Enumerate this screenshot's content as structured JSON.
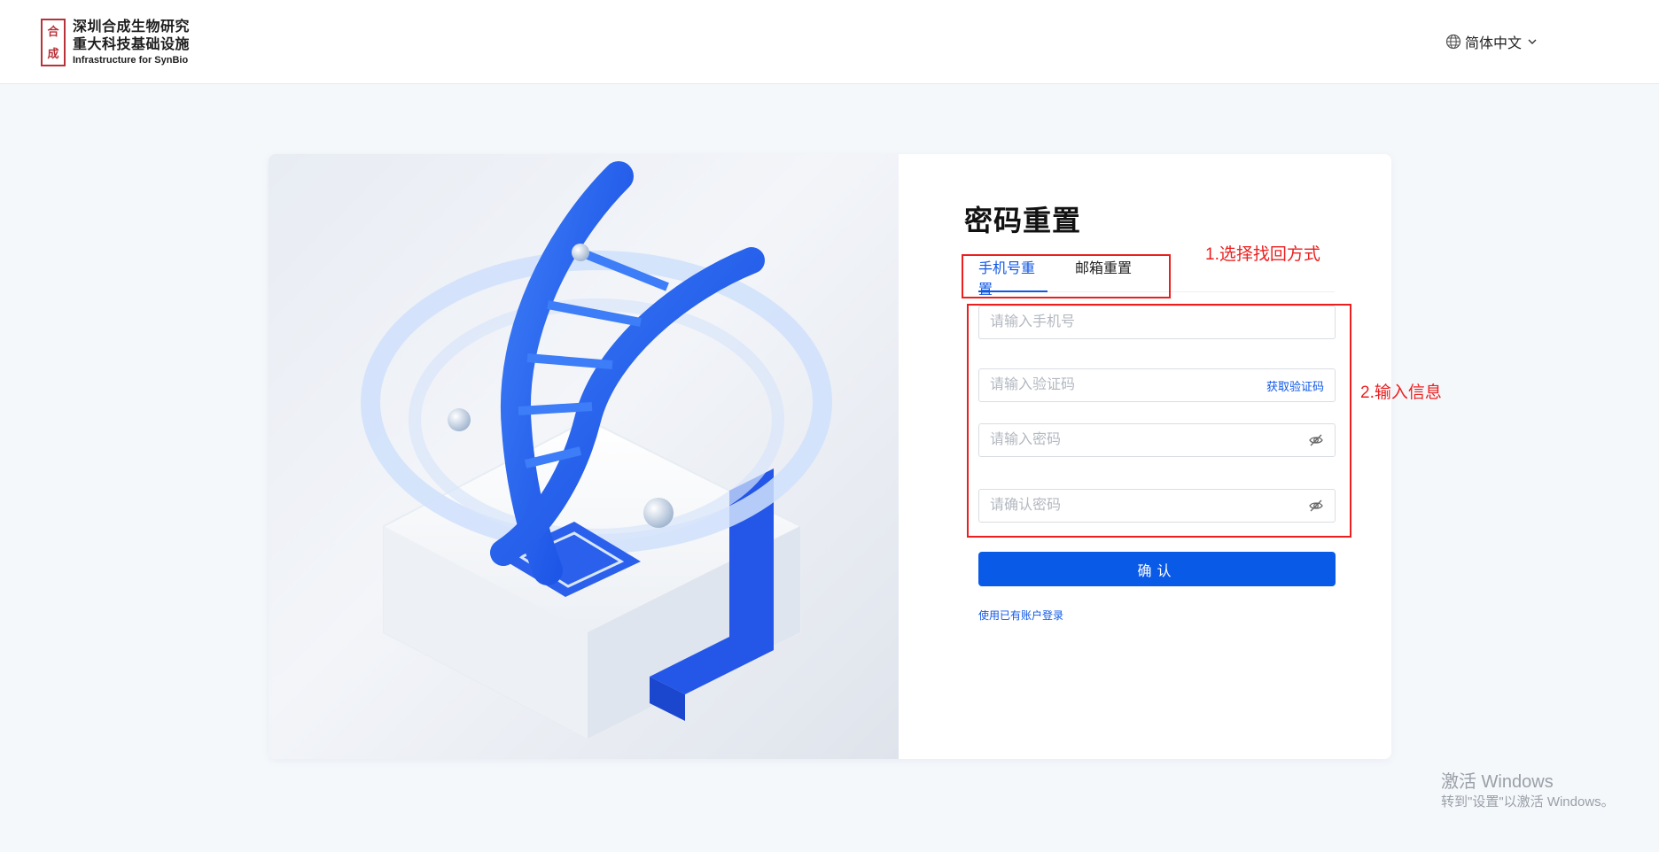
{
  "header": {
    "logo": {
      "seal_chars": [
        "合",
        "成"
      ],
      "line1": "深圳合成生物研究",
      "line2": "重大科技基础设施",
      "line3": "Infrastructure for SynBio"
    },
    "language": {
      "label": "简体中文",
      "icon": "globe-icon"
    }
  },
  "form": {
    "title": "密码重置",
    "tabs": [
      {
        "label": "手机号重置",
        "active": true
      },
      {
        "label": "邮箱重置",
        "active": false
      }
    ],
    "phone_placeholder": "请输入手机号",
    "code_placeholder": "请输入验证码",
    "get_code_label": "获取验证码",
    "password_placeholder": "请输入密码",
    "confirm_password_placeholder": "请确认密码",
    "submit_label": "确认",
    "login_link": "使用已有账户登录"
  },
  "annotations": {
    "step1": "1.选择找回方式",
    "step2": "2.输入信息",
    "color": "#ec1f1f"
  },
  "watermark": {
    "line1": "激活 Windows",
    "line2": "转到\"设置\"以激活 Windows。"
  },
  "colors": {
    "primary": "#0a5ae8",
    "link": "#1058e6",
    "background": "#f5f8fb"
  }
}
